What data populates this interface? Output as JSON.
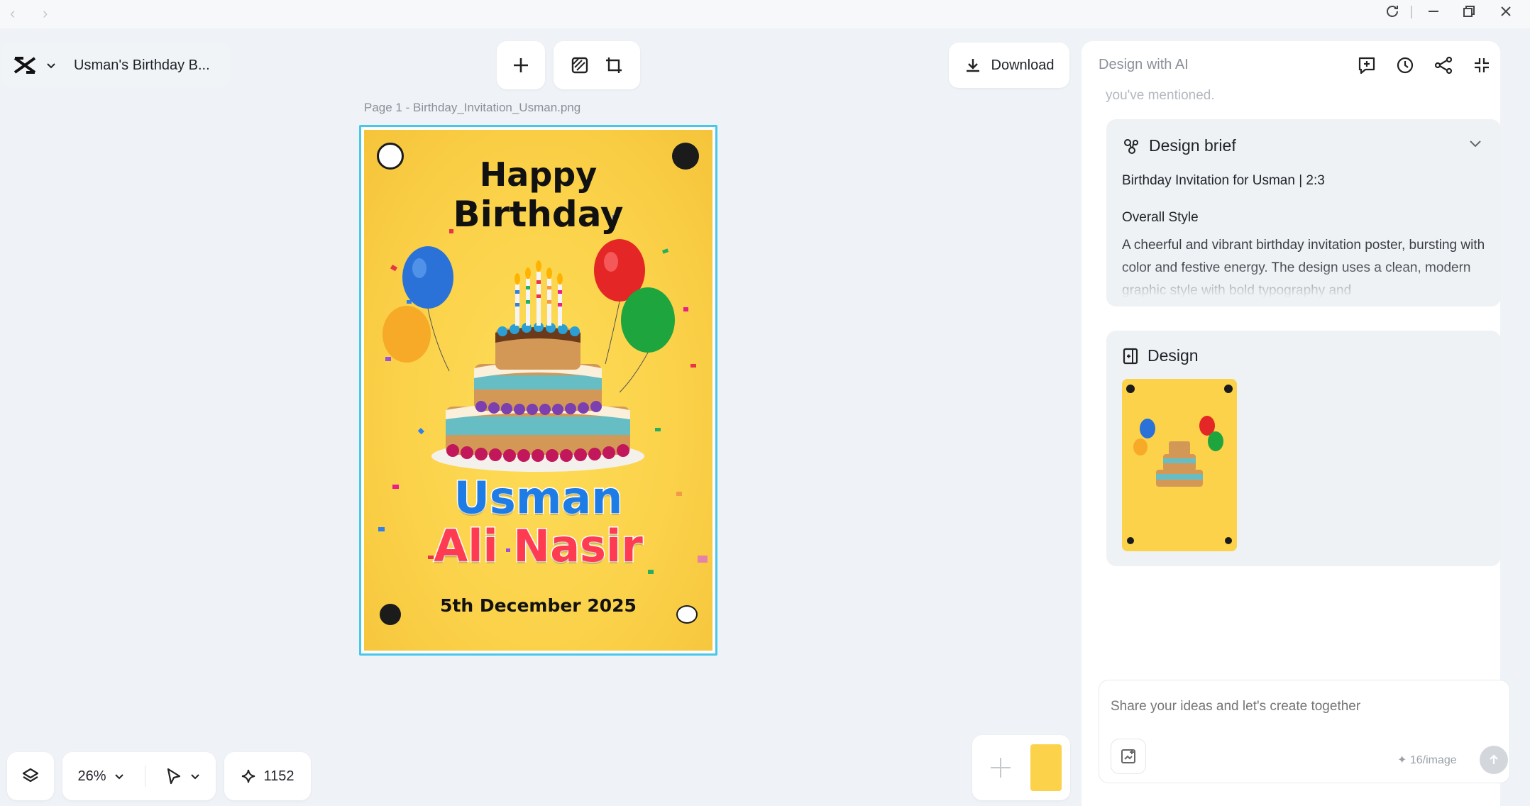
{
  "window": {
    "back": "‹",
    "forward": "›"
  },
  "header": {
    "title": "Usman's Birthday B..."
  },
  "toolbar": {
    "download_label": "Download"
  },
  "canvas": {
    "page_label": "Page 1 -  Birthday_Invitation_Usman.png",
    "poster": {
      "line1": "Happy",
      "line2": "Birthday",
      "name1": "Usman",
      "name2": "Ali Nasir",
      "date": "5th December 2025"
    }
  },
  "ai_panel": {
    "title": "Design with AI",
    "prev_text": "you've mentioned.",
    "brief": {
      "heading": "Design brief",
      "subtitle": "Birthday Invitation for Usman | 2:3",
      "style_heading": "Overall Style",
      "style_body": "A cheerful and vibrant birthday invitation poster, bursting with color and festive energy. The design uses a clean, modern graphic style with bold typography and"
    },
    "design": {
      "heading": "Design"
    },
    "composer": {
      "placeholder": "Share your ideas and let's create together",
      "credits": "✦ 16/image"
    }
  },
  "bottom": {
    "zoom": "26%",
    "credits": "1152"
  },
  "colors": {
    "accent": "#47c8ea",
    "poster_bg": "#fbd24a"
  }
}
